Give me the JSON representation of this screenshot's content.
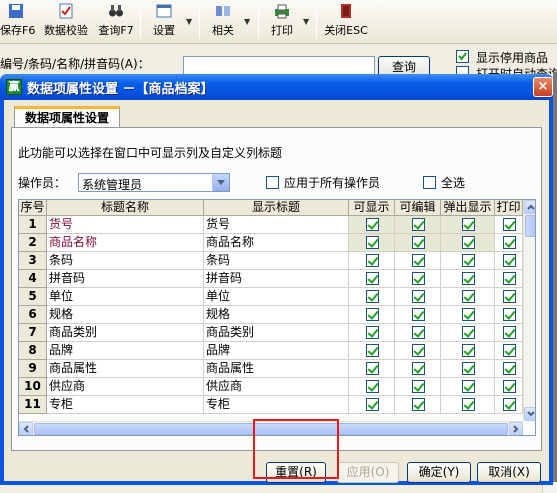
{
  "toolbar": {
    "save_label": "保存F6",
    "validate_label": "数据校验",
    "query_label": "查询F7",
    "settings_label": "设置",
    "related_label": "相关",
    "print_label": "打印",
    "close_label": "关闭ESC"
  },
  "search": {
    "label": "编号/条码/名称/拼音码(A)：",
    "value": "",
    "query_button": "查询"
  },
  "options": {
    "show_disabled_label": "显示停用商品",
    "auto_query_label": "打开时自动查询"
  },
  "dialog": {
    "title": "数据项属性设置 －【商品档案】",
    "close_glyph": "×",
    "app_icon_glyph": "赢",
    "tab_label": "数据项属性设置",
    "info_text": "此功能可以选择在窗口中可显示列及自定义列标题",
    "operator_label": "操作员：",
    "operator_value": "系统管理员",
    "apply_all_label": "应用于所有操作员",
    "select_all_label": "全选",
    "columns": [
      "序号",
      "标题名称",
      "显示标题",
      "可显示",
      "可编辑",
      "弹出显示",
      "打印"
    ],
    "rows": [
      {
        "no": "1",
        "name": "货号",
        "display": "货号",
        "visible": true,
        "editable": true,
        "popup": true,
        "print": true
      },
      {
        "no": "2",
        "name": "商品名称",
        "display": "商品名称",
        "visible": true,
        "editable": true,
        "popup": true,
        "print": true
      },
      {
        "no": "3",
        "name": "条码",
        "display": "条码",
        "visible": true,
        "editable": true,
        "popup": true,
        "print": true
      },
      {
        "no": "4",
        "name": "拼音码",
        "display": "拼音码",
        "visible": true,
        "editable": true,
        "popup": true,
        "print": true
      },
      {
        "no": "5",
        "name": "单位",
        "display": "单位",
        "visible": true,
        "editable": true,
        "popup": true,
        "print": true
      },
      {
        "no": "6",
        "name": "规格",
        "display": "规格",
        "visible": true,
        "editable": true,
        "popup": true,
        "print": true
      },
      {
        "no": "7",
        "name": "商品类别",
        "display": "商品类别",
        "visible": true,
        "editable": true,
        "popup": true,
        "print": true
      },
      {
        "no": "8",
        "name": "品牌",
        "display": "品牌",
        "visible": true,
        "editable": true,
        "popup": true,
        "print": true
      },
      {
        "no": "9",
        "name": "商品属性",
        "display": "商品属性",
        "visible": true,
        "editable": true,
        "popup": true,
        "print": true
      },
      {
        "no": "10",
        "name": "供应商",
        "display": "供应商",
        "visible": true,
        "editable": true,
        "popup": true,
        "print": true
      },
      {
        "no": "11",
        "name": "专柜",
        "display": "专柜",
        "visible": true,
        "editable": true,
        "popup": true,
        "print": true
      }
    ],
    "buttons": {
      "reset": "重置(R)",
      "apply": "应用(O)",
      "ok": "确定(Y)",
      "cancel": "取消(X)"
    }
  },
  "colors": {
    "title_bar": "#0a5ee8",
    "highlight_text": "#7d0a3a",
    "check_green": "#21a121",
    "annotation_red": "#e51b1b"
  }
}
